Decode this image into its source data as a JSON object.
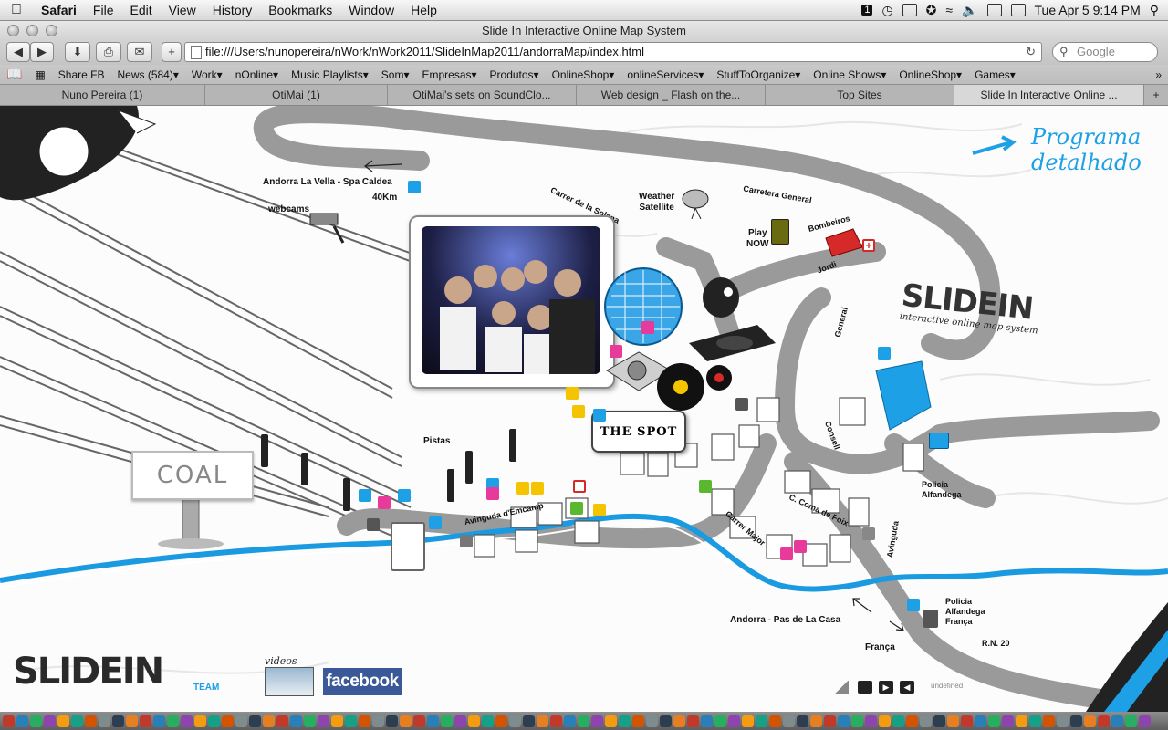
{
  "menubar": {
    "app": "Safari",
    "items": [
      "File",
      "Edit",
      "View",
      "History",
      "Bookmarks",
      "Window",
      "Help"
    ],
    "clock": "Tue Apr 5  9:14 PM",
    "badge": "1"
  },
  "window": {
    "title": "Slide In Interactive Online Map System"
  },
  "toolbar": {
    "url": "file:///Users/nunopereira/nWork/nWork2011/SlideInMap2011/andorraMap/index.html",
    "search_placeholder": "Google"
  },
  "bookmarks": [
    "Share FB",
    "News (584)▾",
    "Work▾",
    "nOnline▾",
    "Music Playlists▾",
    "Som▾",
    "Empresas▾",
    "Produtos▾",
    "OnlineShop▾",
    "onlineServices▾",
    "StuffToOrganize▾",
    "Online Shows▾",
    "OnlineShop▾",
    "Games▾"
  ],
  "tabs": [
    "Nuno Pereira (1)",
    "OtiMai (1)",
    "OtiMai's sets on SoundClo...",
    "Web design _ Flash on the...",
    "Top Sites",
    "Slide In Interactive Online ..."
  ],
  "map": {
    "programa": "Programa\ndetalhado",
    "labels": {
      "andorra_vella": "Andorra La Vella - Spa Caldea",
      "km": "40Km",
      "webcams": "webcams",
      "weather": "Weather\nSatellite",
      "carretera_general": "Carretera General",
      "carrer_solana": "Carrer de la Solana",
      "play_now": "Play\nNOW",
      "bombeiros": "Bombeiros",
      "jordi": "Jordi",
      "general": "General",
      "pistas": "Pistas",
      "the_spot": "THE SPOT",
      "avinguda_emcamp": "Avinguda d'Emcamp",
      "carrer_major": "Carrer Major",
      "c_coma_foix": "C. Coma de Foix",
      "avinguda": "Avinguda",
      "consell": "Consell",
      "policia_alfandega": "Policia\nAlfandega",
      "policia_alfandega_franca": "Policia\nAlfandega\nFrança",
      "pas_de_la_casa": "Andorra - Pas de La Casa",
      "franca": "França",
      "rn20": "R.N. 20",
      "undefined": "undefined"
    },
    "slidein_title": "SLIDEIN",
    "slidein_sub": "interactive online map system",
    "team": "TEAM",
    "coal": "COAL",
    "videos": "videos",
    "facebook": "facebook",
    "colors": {
      "accent_blue": "#1ea0e6",
      "pink": "#e83a9a",
      "yellow": "#f5c400",
      "green": "#5ab82e",
      "red": "#d62a2a",
      "road": "#9a9a9a",
      "river": "#1a9ae0"
    }
  }
}
